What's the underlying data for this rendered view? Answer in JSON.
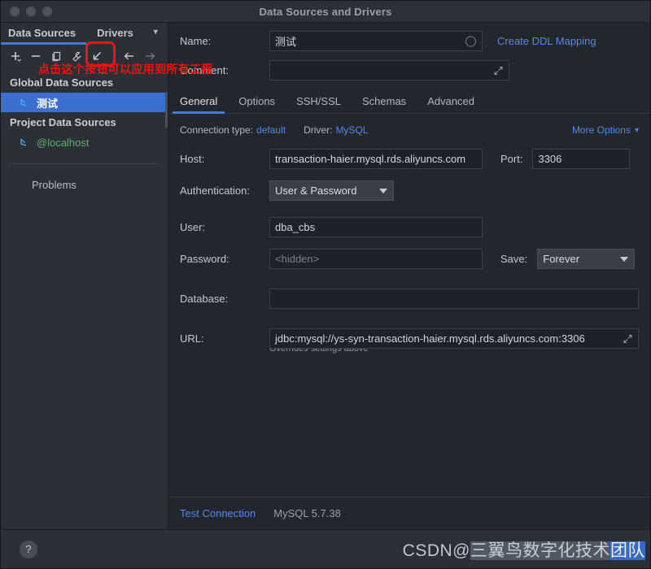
{
  "window": {
    "title": "Data Sources and Drivers"
  },
  "sidebar": {
    "tabs": [
      {
        "label": "Data Sources",
        "active": true
      },
      {
        "label": "Drivers",
        "active": false
      }
    ],
    "chevron_icon": "chevron-down-icon",
    "toolbar": [
      {
        "name": "add-button",
        "icon": "plus-icon"
      },
      {
        "name": "remove-button",
        "icon": "minus-icon"
      },
      {
        "name": "copy-button",
        "icon": "copy-icon"
      },
      {
        "name": "properties-button",
        "icon": "wrench-icon"
      },
      {
        "name": "apply-to-all-projects-button",
        "icon": "arrow-down-left-icon"
      },
      {
        "name": "back-button",
        "icon": "arrow-left-icon"
      },
      {
        "name": "forward-button",
        "icon": "arrow-right-icon"
      }
    ],
    "groups": [
      {
        "title": "Global Data Sources",
        "items": [
          {
            "label": "测试",
            "selected": true,
            "icon": "datasource-icon"
          }
        ]
      },
      {
        "title": "Project Data Sources",
        "items": [
          {
            "label": "@localhost",
            "selected": false,
            "icon": "datasource-icon"
          }
        ]
      }
    ],
    "problems_label": "Problems"
  },
  "annotation": {
    "text": "点击这个按钮可以应用到所有工程",
    "color": "#fb0d0d"
  },
  "main": {
    "name_label": "Name:",
    "name_value": "测试",
    "create_ddl_mapping": "Create DDL Mapping",
    "comment_label": "Comment:",
    "comment_value": "",
    "tabs": [
      {
        "label": "General",
        "active": true
      },
      {
        "label": "Options",
        "active": false
      },
      {
        "label": "SSH/SSL",
        "active": false
      },
      {
        "label": "Schemas",
        "active": false
      },
      {
        "label": "Advanced",
        "active": false
      }
    ],
    "connection_type_label": "Connection type:",
    "connection_type_value": "default",
    "driver_label": "Driver:",
    "driver_value": "MySQL",
    "more_options": "More Options",
    "host_label": "Host:",
    "host_value": "transaction-haier.mysql.rds.aliyuncs.com",
    "port_label": "Port:",
    "port_value": "3306",
    "authentication_label": "Authentication:",
    "authentication_value": "User & Password",
    "user_label": "User:",
    "user_value": "dba_cbs",
    "password_label": "Password:",
    "password_placeholder": "<hidden>",
    "save_label": "Save:",
    "save_value": "Forever",
    "database_label": "Database:",
    "database_value": "",
    "url_label": "URL:",
    "url_value": "jdbc:mysql://ys-syn-transaction-haier.mysql.rds.aliyuncs.com:3306",
    "url_note": "Overrides settings above",
    "test_connection": "Test Connection",
    "server_version": "MySQL 5.7.38"
  },
  "bottom": {
    "help_icon": "question-mark-icon",
    "help_label": "?",
    "watermark_prefix": "CSDN@",
    "watermark_mid": "三翼鸟数字化技术",
    "watermark_tail": "团队"
  },
  "colors": {
    "accent": "#4779d4",
    "link": "#5a87e0",
    "selection": "#3a6fd0",
    "annotation": "#fb0d0d",
    "panel": "#22262d",
    "sidebar": "#2b2f36"
  }
}
